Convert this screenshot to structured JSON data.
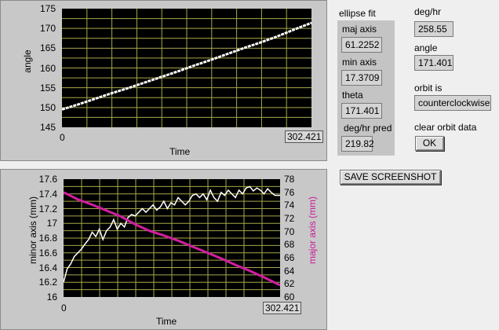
{
  "colors": {
    "plot_bg": "#000000",
    "grid": "#a7a74c",
    "trace_white": "#ffffff",
    "trace_magenta": "#d21ea0",
    "panel": "#c8c8c8"
  },
  "top_chart": {
    "ylabel": "angle",
    "xlabel": "Time",
    "x_start": "0",
    "x_end": "302.421",
    "y_ticks": [
      "175",
      "170",
      "165",
      "160",
      "155",
      "150",
      "145"
    ]
  },
  "bottom_chart": {
    "ylabel_left": "minor axis (mm)",
    "ylabel_right": "major axis (mm)",
    "xlabel": "Time",
    "x_start": "0",
    "x_end": "302.421",
    "y_ticks_left": [
      "17.6",
      "17.4",
      "17.2",
      "17",
      "16.8",
      "16.6",
      "16.4",
      "16.2",
      "16"
    ],
    "y_ticks_right": [
      "78",
      "76",
      "74",
      "72",
      "70",
      "68",
      "66",
      "64",
      "62",
      "60"
    ]
  },
  "chart_data": [
    {
      "type": "scatter",
      "title": "",
      "xlabel": "Time",
      "ylabel": "angle",
      "xlim": [
        0,
        302.421
      ],
      "ylim": [
        145,
        175
      ],
      "grid": true,
      "series": [
        {
          "x": [
            0,
            20,
            40,
            60,
            80,
            100,
            120,
            140,
            160,
            180,
            200,
            220,
            240,
            260,
            280,
            302.421
          ],
          "values": [
            149.5,
            150.8,
            152.2,
            153.6,
            154.9,
            156.3,
            157.7,
            159.1,
            160.6,
            162.0,
            163.5,
            165.0,
            166.4,
            167.9,
            169.6,
            171.4
          ]
        }
      ]
    },
    {
      "type": "line",
      "title": "",
      "xlabel": "Time",
      "ylabel": "minor axis (mm)",
      "y2label": "major axis (mm)",
      "xlim": [
        0,
        302.421
      ],
      "ylim": [
        16,
        17.6
      ],
      "y2lim": [
        60,
        78
      ],
      "grid": true,
      "series": [
        {
          "axis": "left",
          "x": [
            0,
            5,
            10,
            15,
            20,
            25,
            30,
            35,
            40,
            45,
            50,
            55,
            60,
            65,
            70,
            75,
            80,
            85,
            90,
            95,
            100,
            105,
            110,
            115,
            120,
            125,
            130,
            135,
            140,
            145,
            150,
            155,
            160,
            165,
            170,
            175,
            180,
            185,
            190,
            195,
            200,
            205,
            210,
            215,
            220,
            225,
            230,
            235,
            240,
            245,
            250,
            255,
            260,
            265,
            270,
            275,
            280,
            285,
            290,
            295,
            302.421
          ],
          "values": [
            16.2,
            16.38,
            16.45,
            16.55,
            16.6,
            16.65,
            16.72,
            16.78,
            16.88,
            16.82,
            16.92,
            16.78,
            16.9,
            16.95,
            17.05,
            16.92,
            17.0,
            16.95,
            17.08,
            17.12,
            17.1,
            17.15,
            17.2,
            17.15,
            17.2,
            17.25,
            17.18,
            17.22,
            17.3,
            17.2,
            17.28,
            17.25,
            17.35,
            17.3,
            17.25,
            17.3,
            17.38,
            17.4,
            17.35,
            17.4,
            17.32,
            17.45,
            17.35,
            17.3,
            17.42,
            17.38,
            17.45,
            17.4,
            17.35,
            17.45,
            17.4,
            17.48,
            17.5,
            17.44,
            17.48,
            17.45,
            17.4,
            17.47,
            17.42,
            17.38,
            17.38
          ]
        },
        {
          "axis": "right",
          "x": [
            0,
            20,
            40,
            60,
            80,
            100,
            120,
            140,
            160,
            180,
            200,
            220,
            240,
            260,
            280,
            302.421
          ],
          "values": [
            76.0,
            74.9,
            74.1,
            73.2,
            72.3,
            71.1,
            70.1,
            69.4,
            68.6,
            67.7,
            66.8,
            65.9,
            64.9,
            64.0,
            63.0,
            61.8
          ]
        }
      ]
    }
  ],
  "ellipse_fit": {
    "title": "ellipse fit",
    "maj_label": "maj axis",
    "maj_value": "61.2252",
    "min_label": "min axis",
    "min_value": "17.3709",
    "theta_label": "theta",
    "theta_value": "171.401",
    "pred_label": "deg/hr pred",
    "pred_value": "219.82"
  },
  "right_col": {
    "deghr_label": "deg/hr",
    "deghr_value": "258.55",
    "angle_label": "angle",
    "angle_value": "171.401",
    "orbit_label": "orbit is",
    "orbit_value": "counterclockwise",
    "clear_label": "clear orbit data",
    "ok_label": "OK"
  },
  "save_label": "SAVE SCREENSHOT"
}
